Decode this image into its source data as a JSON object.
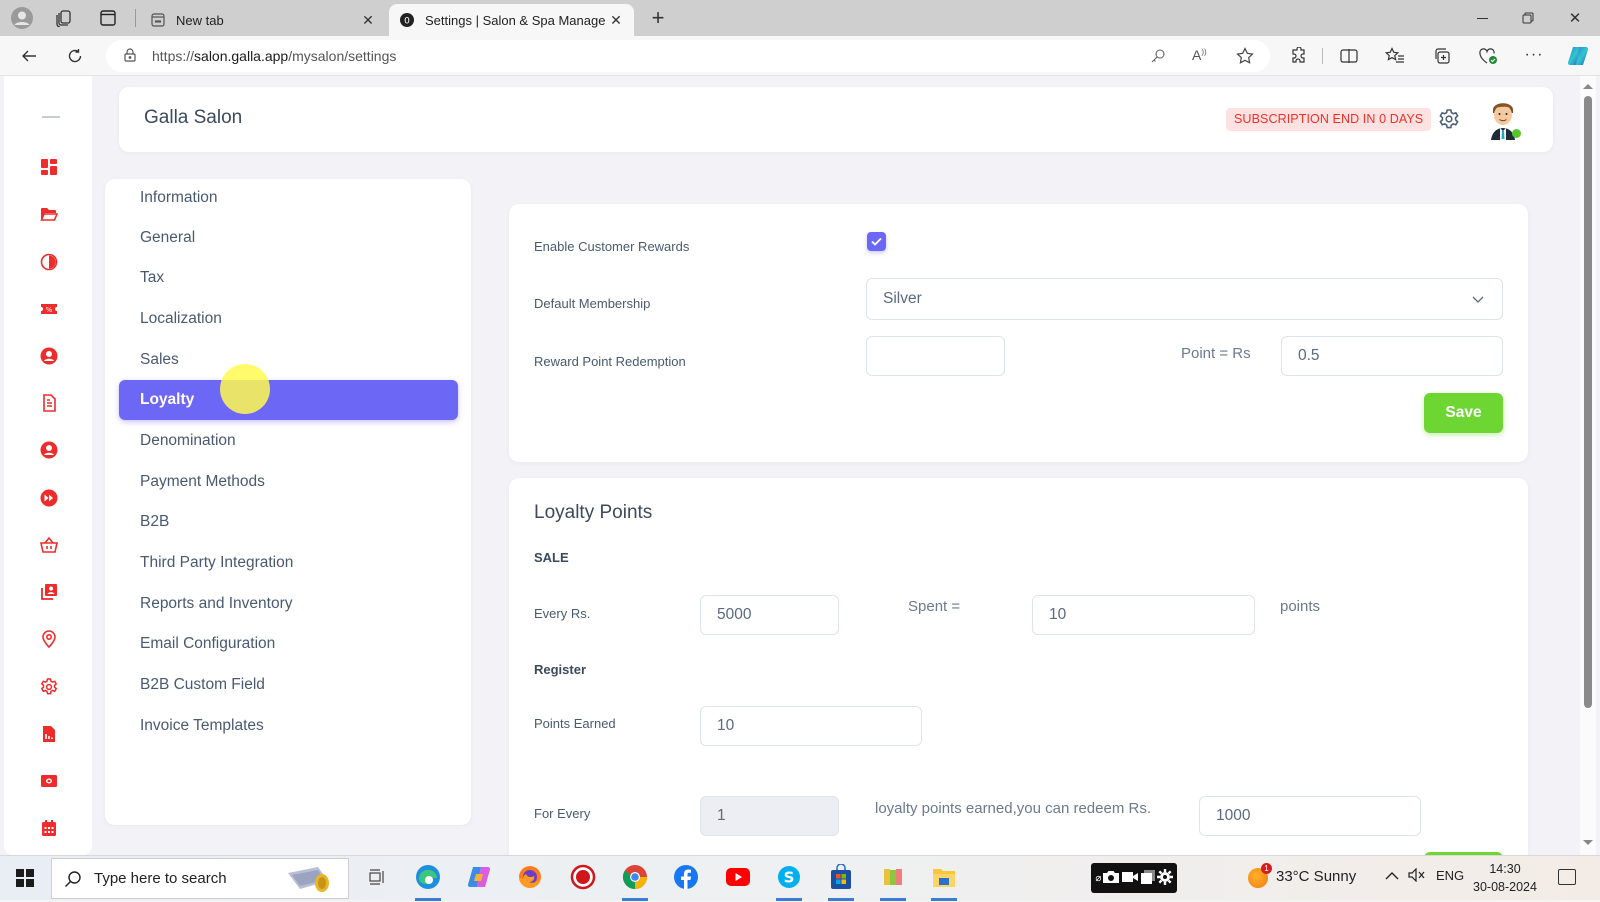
{
  "browser": {
    "tabs": [
      {
        "title": "New tab",
        "active": false
      },
      {
        "title": "Settings | Salon & Spa Manageme",
        "active": true
      }
    ],
    "new_tab_label": "+",
    "url_prefix": "https://",
    "url_host": "salon.galla.app",
    "url_path": "/mysalon/settings",
    "window_controls": [
      "minimize",
      "restore",
      "close"
    ]
  },
  "app": {
    "brand": "Galla Salon",
    "subscription_badge": "SUBSCRIPTION END IN 0 DAYS",
    "accent_color": "#6c68f5",
    "rail_icon_color": "#ef2b2b",
    "rail_icons": [
      "dashboard-icon",
      "folder-open-icon",
      "contrast-icon",
      "coupon-icon",
      "user-circle-icon",
      "document-icon",
      "user-circle-icon",
      "fast-forward-icon",
      "basket-icon",
      "contacts-icon",
      "location-pin-icon",
      "gear-icon",
      "report-icon",
      "cash-icon",
      "calendar-icon"
    ]
  },
  "settings_menu": {
    "items": [
      {
        "label": "Information"
      },
      {
        "label": "General"
      },
      {
        "label": "Tax"
      },
      {
        "label": "Localization"
      },
      {
        "label": "Sales"
      },
      {
        "label": "Loyalty",
        "active": true
      },
      {
        "label": "Denomination"
      },
      {
        "label": "Payment Methods"
      },
      {
        "label": "B2B"
      },
      {
        "label": "Third Party Integration"
      },
      {
        "label": "Reports and Inventory"
      },
      {
        "label": "Email Configuration"
      },
      {
        "label": "B2B Custom Field"
      },
      {
        "label": "Invoice Templates"
      }
    ]
  },
  "rewards": {
    "enable_label": "Enable Customer Rewards",
    "enable_checked": true,
    "membership_label": "Default Membership",
    "membership_value": "Silver",
    "redemption_label": "Reward Point Redemption",
    "redemption_points_value": "",
    "point_equals_label": "Point = Rs",
    "point_rs_value": "0.5",
    "save_label": "Save"
  },
  "loyalty_points": {
    "title": "Loyalty Points",
    "sale_heading": "SALE",
    "every_rs_label": "Every Rs.",
    "every_rs_value": "5000",
    "spent_label": "Spent =",
    "spent_points_value": "10",
    "points_suffix": "points",
    "register_heading": "Register",
    "points_earned_label": "Points Earned",
    "points_earned_value": "10",
    "for_every_label": "For Every",
    "for_every_value": "1",
    "redeem_text": "loyalty points earned,you can redeem Rs.",
    "redeem_value": "1000"
  },
  "taskbar": {
    "search_placeholder": "Type here to search",
    "apps": [
      "edge",
      "copilot",
      "firefox",
      "record",
      "chrome",
      "facebook",
      "youtube",
      "skype",
      "store",
      "winrar",
      "file-explorer"
    ],
    "weather": "33°C  Sunny",
    "weather_badge": "1",
    "language": "ENG",
    "time": "14:30",
    "date": "30-08-2024"
  }
}
